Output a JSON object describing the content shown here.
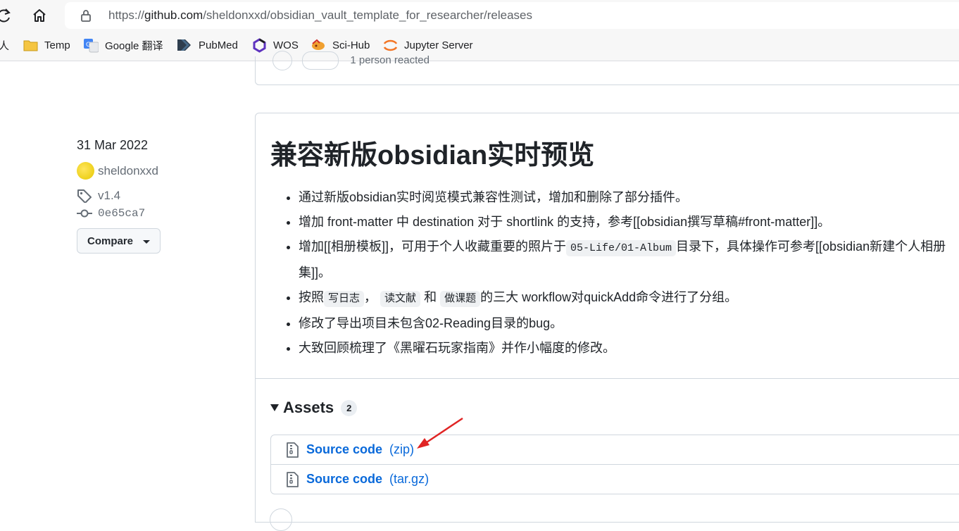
{
  "browser": {
    "url_prefix": "https://",
    "url_host": "github.com",
    "url_path": "/sheldonxxd/obsidian_vault_template_for_researcher/releases",
    "bookmarks": [
      {
        "label": "人",
        "icon": "partial"
      },
      {
        "label": "Temp",
        "icon": "folder-icon"
      },
      {
        "label": "Google 翻译",
        "icon": "google-translate-icon"
      },
      {
        "label": "PubMed",
        "icon": "pubmed-icon"
      },
      {
        "label": "WOS",
        "icon": "wos-icon"
      },
      {
        "label": "Sci-Hub",
        "icon": "scihub-icon"
      },
      {
        "label": "Jupyter Server",
        "icon": "jupyter-icon"
      }
    ]
  },
  "previous_release": {
    "reaction_text": "1 person reacted"
  },
  "sidebar": {
    "date": "31 Mar 2022",
    "author": "sheldonxxd",
    "tag": "v1.4",
    "commit": "0e65ca7",
    "compare_label": "Compare"
  },
  "release": {
    "title": "兼容新版obsidian实时预览",
    "notes": [
      {
        "t1": "通过新版obsidian实时阅览模式兼容性测试，增加和删除了部分插件。"
      },
      {
        "t1": "增加 front-matter 中 destination 对于 shortlink 的支持，参考[[obsidian撰写草稿#front-matter]]。"
      },
      {
        "t1": "增加[[相册模板]]，可用于个人收藏重要的照片于",
        "c1": "05-Life/01-Album",
        "t2": "目录下，具体操作可参考[[obsidian新建个人相册",
        "t3": "集]]。"
      },
      {
        "t1": "按照",
        "c1": "写日志",
        "t2": "，",
        "c2": "读文献",
        "t3": "和",
        "c3": "做课题",
        "t4": "的三大 workflow对quickAdd命令进行了分组。"
      },
      {
        "t1": "修改了导出项目未包含02-Reading目录的bug。"
      },
      {
        "t1": "大致回顾梳理了《黑曜石玩家指南》并作小幅度的修改。"
      }
    ]
  },
  "assets": {
    "title": "Assets",
    "count": "2",
    "items": [
      {
        "name": "Source code",
        "ext": "(zip)"
      },
      {
        "name": "Source code",
        "ext": "(tar.gz)"
      }
    ]
  },
  "colors": {
    "link": "#0969da",
    "annotation_arrow": "#e02424",
    "border": "#d0d7de"
  }
}
